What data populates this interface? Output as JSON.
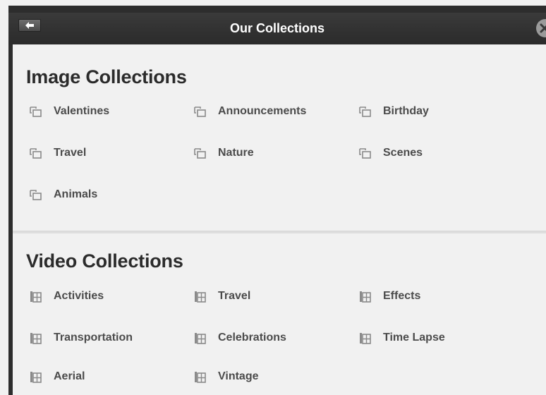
{
  "header": {
    "title": "Our Collections",
    "back_icon": "back-arrow-icon",
    "close_icon": "close-icon"
  },
  "image_collections": {
    "title": "Image Collections",
    "icon": "image-gallery-icon",
    "items": [
      {
        "label": "Valentines"
      },
      {
        "label": "Announcements"
      },
      {
        "label": "Birthday"
      },
      {
        "label": "Travel"
      },
      {
        "label": "Nature"
      },
      {
        "label": "Scenes"
      },
      {
        "label": "Animals"
      }
    ]
  },
  "video_collections": {
    "title": "Video Collections",
    "icon": "film-icon",
    "items": [
      {
        "label": "Activities"
      },
      {
        "label": "Travel"
      },
      {
        "label": "Effects"
      },
      {
        "label": "Transportation"
      },
      {
        "label": "Celebrations"
      },
      {
        "label": "Time Lapse"
      },
      {
        "label": "Aerial"
      },
      {
        "label": "Vintage"
      }
    ]
  },
  "colors": {
    "header_bg": "#343434",
    "content_bg": "#f1f1f1",
    "title_text": "#2b2b2b",
    "item_text": "#4b4b4b",
    "icon": "#8a8a8a"
  }
}
